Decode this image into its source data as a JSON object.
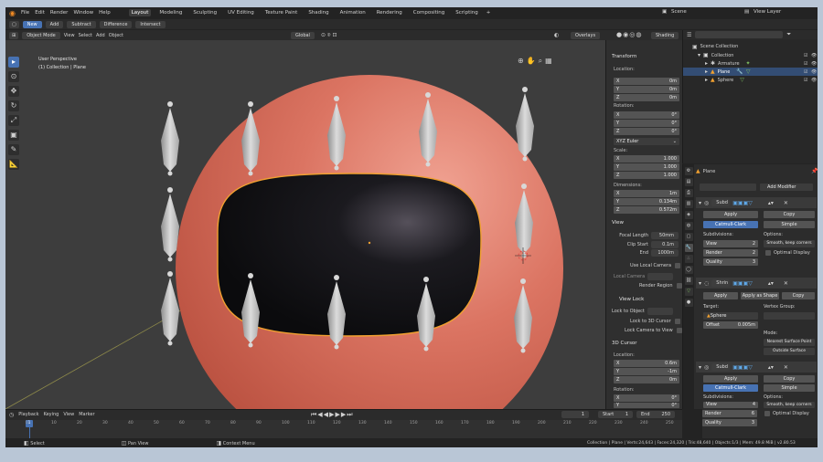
{
  "menu": [
    "File",
    "Edit",
    "Render",
    "Window",
    "Help"
  ],
  "workspaces": [
    "Layout",
    "Modeling",
    "Sculpting",
    "UV Editing",
    "Texture Paint",
    "Shading",
    "Animation",
    "Rendering",
    "Compositing",
    "Scripting"
  ],
  "active_workspace": "Layout",
  "scene": "Scene",
  "view_layer": "View Layer",
  "header2": {
    "new": "New",
    "add": "Add",
    "subtract": "Subtract",
    "difference": "Difference",
    "intersect": "Intersect"
  },
  "viewport_header": {
    "mode": "Object Mode",
    "view": "View",
    "select": "Select",
    "add": "Add",
    "object": "Object",
    "transform": "Global",
    "overlays": "Overlays",
    "shading": "Shading"
  },
  "viewport": {
    "info1": "User Perspective",
    "info2": "(1) Collection | Plane"
  },
  "transform": {
    "title": "Transform",
    "location_label": "Location:",
    "loc": {
      "x": "0m",
      "y": "0m",
      "z": "0m"
    },
    "rotation_label": "Rotation:",
    "rot": {
      "x": "0°",
      "y": "0°",
      "z": "0°"
    },
    "rotation_mode": "XYZ Euler",
    "scale_label": "Scale:",
    "scale": {
      "x": "1.000",
      "y": "1.000",
      "z": "1.000"
    },
    "dimensions_label": "Dimensions:",
    "dim": {
      "x": "1m",
      "y": "0.134m",
      "z": "0.572m"
    }
  },
  "view": {
    "title": "View",
    "focal_length_label": "Focal Length",
    "focal_length": "50mm",
    "clip_start_label": "Clip Start",
    "clip_start": "0.1m",
    "end_label": "End",
    "end": "1000m",
    "use_local_camera": "Use Local Camera",
    "local_camera": "Local Camera",
    "render_region": "Render Region",
    "view_lock": "View Lock",
    "lock_to_object": "Lock to Object",
    "lock_3d_cursor": "Lock to 3D Cursor",
    "lock_camera": "Lock Camera to View"
  },
  "cursor": {
    "title": "3D Cursor",
    "location_label": "Location:",
    "x": "0.6m",
    "y": "-1m",
    "z": "0m",
    "rotation_label": "Rotation:",
    "rx": "0°",
    "ry": "0°"
  },
  "outliner": {
    "scene_collection": "Scene Collection",
    "collection": "Collection",
    "items": [
      {
        "name": "Armature"
      },
      {
        "name": "Plane"
      },
      {
        "name": "Sphere"
      }
    ]
  },
  "properties": {
    "object": "Plane",
    "add_modifier": "Add Modifier",
    "mod1": {
      "name": "Subd",
      "apply": "Apply",
      "copy": "Copy",
      "catmull": "Catmull-Clark",
      "simple": "Simple",
      "subdivisions": "Subdivisions:",
      "view_label": "View",
      "view": "2",
      "render_label": "Render",
      "render": "2",
      "quality_label": "Quality",
      "quality": "3",
      "options": "Options:",
      "uv": "Smooth, keep corners",
      "optimal": "Optimal Display"
    },
    "mod2": {
      "name": "Shrin",
      "apply": "Apply",
      "apply_shape": "Apply as Shape",
      "copy": "Copy",
      "target": "Target:",
      "target_val": "Sphere",
      "vertex_group": "Vertex Group:",
      "offset_label": "Offset",
      "offset": "0.005m",
      "mode": "Mode:",
      "mode_val": "Nearest Surface Point",
      "outside": "Outside Surface"
    },
    "mod3": {
      "name": "Subd",
      "apply": "Apply",
      "copy": "Copy",
      "catmull": "Catmull-Clark",
      "simple": "Simple",
      "subdivisions": "Subdivisions:",
      "view_label": "View",
      "view": "4",
      "render_label": "Render",
      "render": "6",
      "quality_label": "Quality",
      "quality": "3",
      "options": "Options:",
      "uv": "Smooth, keep corners",
      "optimal": "Optimal Display"
    }
  },
  "timeline": {
    "playback": "Playback",
    "keying": "Keying",
    "view": "View",
    "marker": "Marker",
    "frame": "1",
    "start_label": "Start",
    "start": "1",
    "end_label": "End",
    "end": "250",
    "ticks": [
      "0",
      "10",
      "20",
      "30",
      "40",
      "50",
      "60",
      "70",
      "80",
      "90",
      "100",
      "110",
      "120",
      "130",
      "140",
      "150",
      "160",
      "170",
      "180",
      "190",
      "200",
      "210",
      "220",
      "230",
      "240",
      "250"
    ]
  },
  "status": {
    "select": "Select",
    "pan": "Pan View",
    "context": "Context Menu",
    "stats": "Collection | Plane | Verts:24,643 | Faces:24,320 | Tris:48,640 | Objects:1/3 | Mem: 49.8 MiB | v2.80.53"
  },
  "colors": {
    "accent": "#4772b3",
    "sphere": "#d8705e",
    "opening": "#101013",
    "highlight": "#f0a030"
  }
}
